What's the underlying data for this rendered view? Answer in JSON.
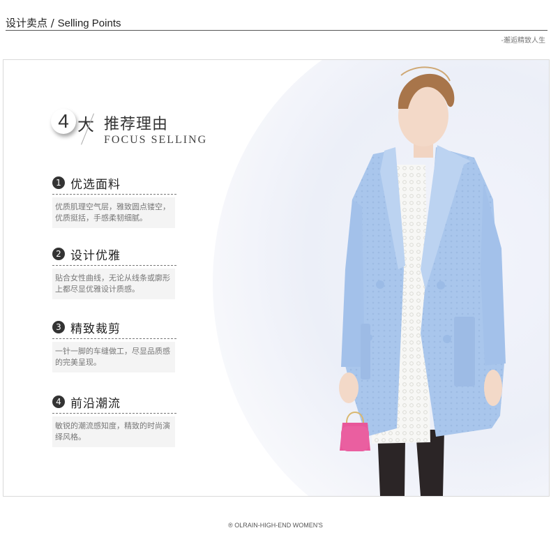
{
  "header": {
    "title_cn": "设计卖点",
    "sep": " / ",
    "title_en": "Selling Points",
    "tagline": "-邂逅精致人生"
  },
  "headline": {
    "number": "4",
    "da": "大",
    "title_cn": "推荐理由",
    "title_en": "FOCUS SELLING"
  },
  "points": [
    {
      "num": "1",
      "title": "优选面料",
      "text": "优质肌理空气层，雅致圆点镂空，优质挺括，手感柔韧细腻。"
    },
    {
      "num": "2",
      "title": "设计优雅",
      "text": "贴合女性曲线，无论从线条或廓形上都尽显优雅设计质感。"
    },
    {
      "num": "3",
      "title": "精致裁剪",
      "text": "一针一脚的车缝做工，尽显品质感的完美呈现。"
    },
    {
      "num": "4",
      "title": "前沿潮流",
      "text": "敏锐的潮流感知度，精致的时尚演绎风格。"
    }
  ],
  "footer": {
    "brand": "® OLRAIN-HIGH-END WOMEN'S"
  },
  "colors": {
    "coat": "#a9c6ec",
    "coat_shadow": "#8fb0de",
    "tights": "#2b2526",
    "bag": "#e8579a",
    "hair": "#a8754a",
    "skin": "#f3d9c8"
  }
}
